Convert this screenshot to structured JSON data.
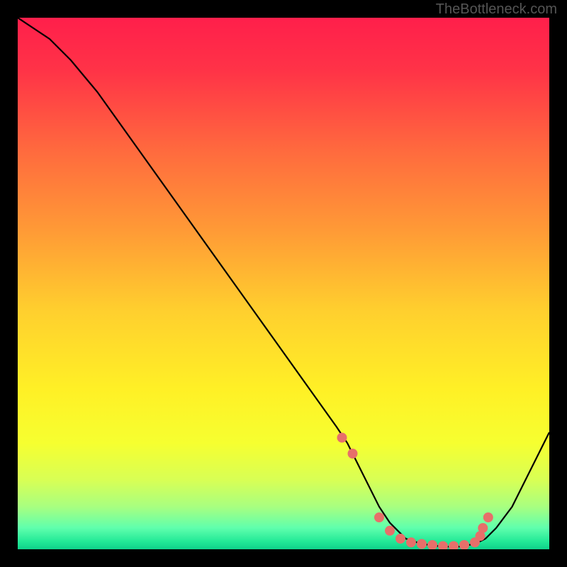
{
  "watermark": "TheBottleneck.com",
  "chart_data": {
    "type": "line",
    "title": "",
    "xlabel": "",
    "ylabel": "",
    "xlim": [
      0,
      100
    ],
    "ylim": [
      0,
      100
    ],
    "curve": {
      "name": "bottleneck-curve",
      "x": [
        0,
        6,
        10,
        15,
        20,
        25,
        30,
        35,
        40,
        45,
        50,
        55,
        60,
        62,
        65,
        68,
        70,
        73,
        76,
        80,
        83,
        86,
        88,
        90,
        93,
        96,
        100
      ],
      "y": [
        100,
        96,
        92,
        86,
        79,
        72,
        65,
        58,
        51,
        44,
        37,
        30,
        23,
        20,
        14,
        8,
        5,
        2,
        1,
        0.5,
        0.5,
        1,
        2,
        4,
        8,
        14,
        22
      ]
    },
    "markers": {
      "name": "highlight-dots",
      "color": "#e76f6a",
      "x": [
        61,
        63,
        68,
        70,
        72,
        74,
        76,
        78,
        80,
        82,
        84,
        86,
        87,
        87.5,
        88.5
      ],
      "y": [
        21,
        18,
        6,
        3.5,
        2,
        1.3,
        1,
        0.8,
        0.6,
        0.6,
        0.8,
        1.3,
        2.5,
        4,
        6
      ]
    },
    "gradient_stops": [
      {
        "offset": 0.0,
        "color": "#ff1f4b"
      },
      {
        "offset": 0.1,
        "color": "#ff3347"
      },
      {
        "offset": 0.25,
        "color": "#ff6a3e"
      },
      {
        "offset": 0.4,
        "color": "#ff9a36"
      },
      {
        "offset": 0.55,
        "color": "#ffcf2e"
      },
      {
        "offset": 0.7,
        "color": "#fff026"
      },
      {
        "offset": 0.8,
        "color": "#f6ff30"
      },
      {
        "offset": 0.87,
        "color": "#d8ff55"
      },
      {
        "offset": 0.92,
        "color": "#a8ff80"
      },
      {
        "offset": 0.96,
        "color": "#5fffad"
      },
      {
        "offset": 0.985,
        "color": "#23e997"
      },
      {
        "offset": 1.0,
        "color": "#0fd18a"
      }
    ]
  }
}
